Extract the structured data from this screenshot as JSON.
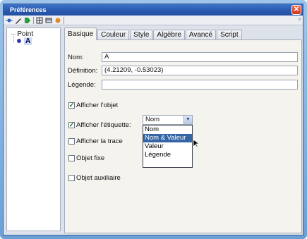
{
  "window": {
    "title": "Préférences",
    "close_glyph": "✕"
  },
  "toolbar": {
    "icons": [
      "point-icon",
      "pen-icon",
      "grid-icon",
      "table-icon",
      "tag-icon"
    ],
    "right_glyph": "ª"
  },
  "tree": {
    "root_label": "Point",
    "child_label": "A"
  },
  "tabs": [
    "Basique",
    "Couleur",
    "Style",
    "Algèbre",
    "Avancé",
    "Script"
  ],
  "form": {
    "name_label": "Nom:",
    "name_value": "A",
    "definition_label": "Définition:",
    "definition_value": "(4.21209, -0.53023)",
    "legend_label": "Légende:",
    "legend_value": ""
  },
  "checks": {
    "show_object": "Afficher l'objet",
    "show_label": "Afficher l'étiquette:",
    "show_trace": "Afficher la trace",
    "fixed_object": "Objet fixe",
    "aux_object": "Objet auxiliaire",
    "check_glyph": "✓"
  },
  "label_select": {
    "current": "Nom",
    "options": [
      "Nom",
      "Nom & Valeur",
      "Valeur",
      "Légende"
    ],
    "highlighted": "Nom & Valeur",
    "arrow_glyph": "▼"
  },
  "colors": {
    "title_bar": "#2b5cb2",
    "selection": "#3465a4",
    "frame": "#7fb0e0"
  }
}
